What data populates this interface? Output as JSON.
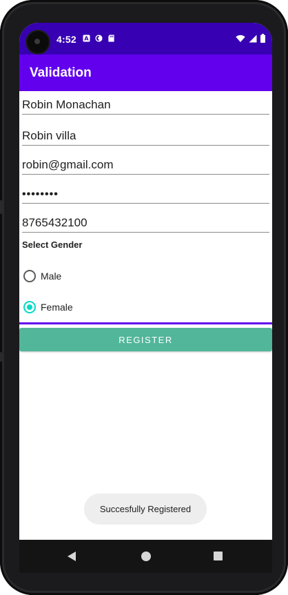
{
  "status_bar": {
    "time": "4:52",
    "icons": [
      "a-notification-icon",
      "sync-icon",
      "sd-card-icon"
    ],
    "system_icons": [
      "wifi-icon",
      "signal-icon",
      "battery-icon"
    ],
    "background": "#3700b3"
  },
  "app_bar": {
    "title": "Validation",
    "background": "#6200ee"
  },
  "form": {
    "name_value": "Robin Monachan",
    "address_value": "Robin villa",
    "email_value": "robin@gmail.com",
    "password_value": "••••••••",
    "phone_value": "8765432100",
    "gender_label": "Select Gender",
    "gender_options": [
      {
        "label": "Male",
        "checked": false
      },
      {
        "label": "Female",
        "checked": true
      }
    ],
    "register_label": "REGISTER",
    "accent_color": "#03dac5",
    "button_color": "#52b69a"
  },
  "toast": {
    "message": "Succesfully Registered"
  },
  "nav_bar": {
    "buttons": [
      "back-icon",
      "home-icon",
      "recents-icon"
    ]
  }
}
